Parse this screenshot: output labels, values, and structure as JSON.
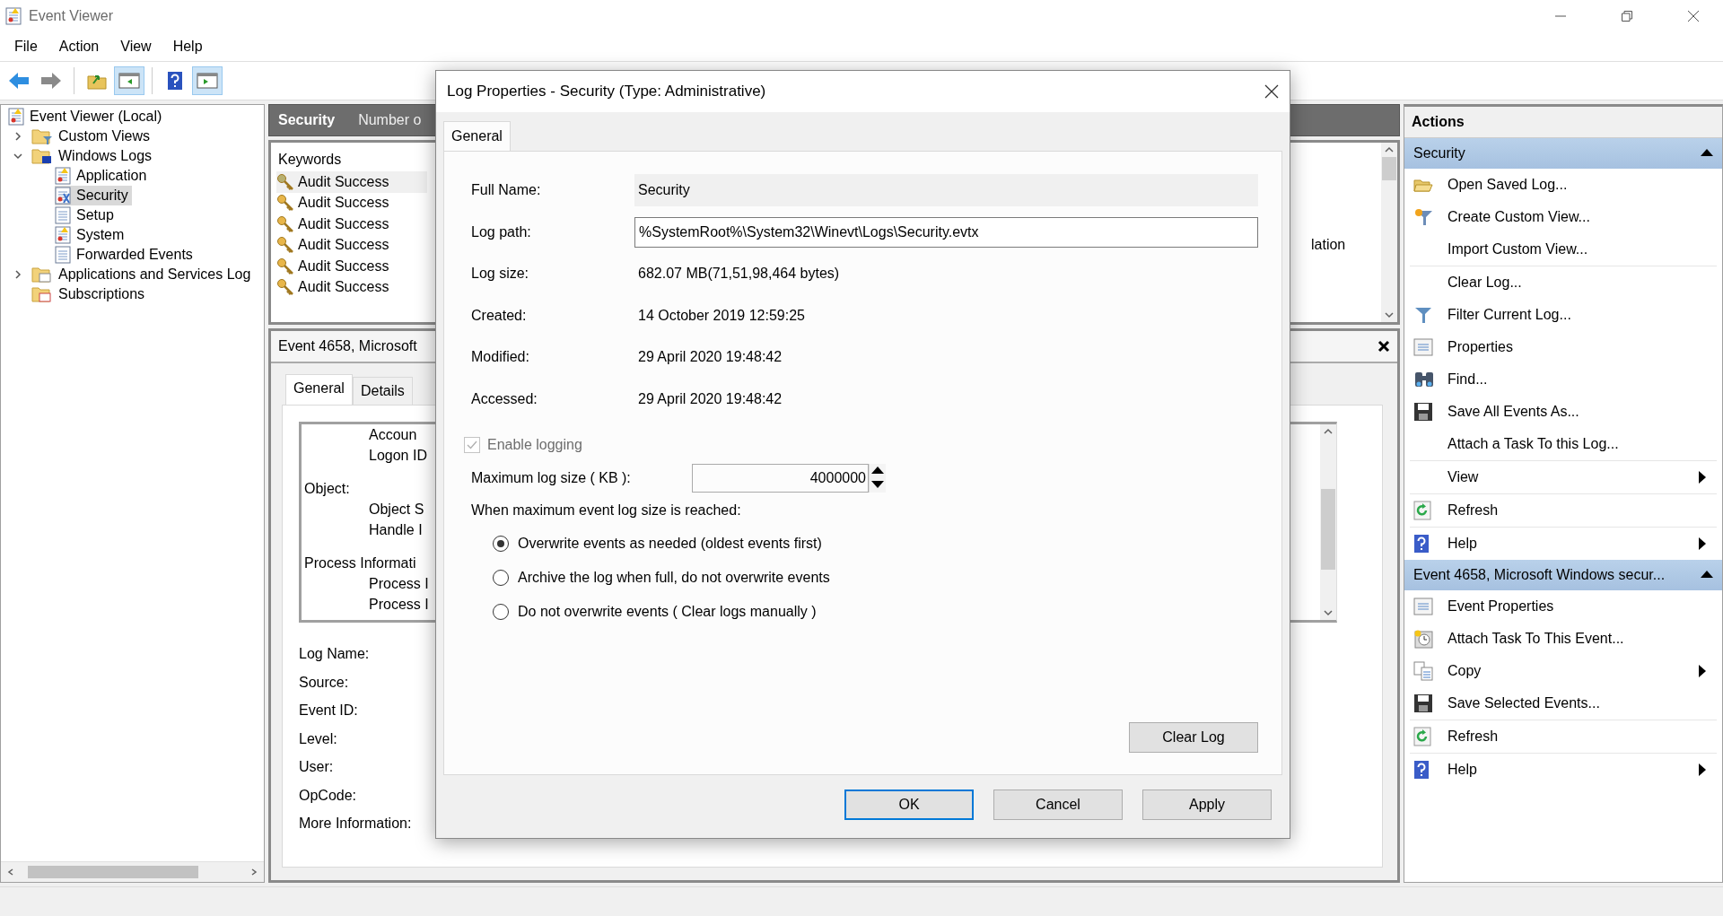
{
  "window": {
    "title": "Event Viewer"
  },
  "menu": [
    "File",
    "Action",
    "View",
    "Help"
  ],
  "toolbar_groups": [
    [
      {
        "kind": "back",
        "pressed": false
      },
      {
        "kind": "forward",
        "pressed": false
      }
    ],
    [
      {
        "kind": "up",
        "pressed": false
      },
      {
        "kind": "tree-pane",
        "pressed": true
      }
    ],
    [
      {
        "kind": "help",
        "pressed": false
      },
      {
        "kind": "action-pane",
        "pressed": true
      }
    ]
  ],
  "tree": [
    {
      "label": "Event Viewer (Local)",
      "kind": "viewer",
      "selected": false,
      "children": [
        {
          "label": "Custom Views",
          "kind": "filter-folder",
          "selected": false,
          "expanded": false
        },
        {
          "label": "Windows Logs",
          "kind": "logs-folder",
          "selected": false,
          "expanded": true,
          "children": [
            {
              "label": "Application",
              "kind": "log",
              "selected": false
            },
            {
              "label": "Security",
              "kind": "security-log",
              "selected": true
            },
            {
              "label": "Setup",
              "kind": "plain-log",
              "selected": false
            },
            {
              "label": "System",
              "kind": "log",
              "selected": false
            },
            {
              "label": "Forwarded Events",
              "kind": "plain-log",
              "selected": false
            }
          ]
        },
        {
          "label": "Applications and Services Log",
          "kind": "folder",
          "selected": false,
          "expanded": false
        },
        {
          "label": "Subscriptions",
          "kind": "subscriptions",
          "selected": false
        }
      ]
    }
  ],
  "log_header": {
    "title": "Security",
    "column_2": "Number o"
  },
  "event_list": {
    "column": "Keywords",
    "column_2_text": "lation",
    "rows": [
      {
        "text": "Audit Success",
        "selected": true
      },
      {
        "text": "Audit Success",
        "selected": false
      },
      {
        "text": "Audit Success",
        "selected": false
      },
      {
        "text": "Audit Success",
        "selected": false
      },
      {
        "text": "Audit Success",
        "selected": false
      },
      {
        "text": "Audit Success",
        "selected": false
      }
    ]
  },
  "event_detail": {
    "title": "Event 4658, Microsoft",
    "tabs": [
      {
        "label": "General",
        "selected": true
      },
      {
        "label": "Details",
        "selected": false
      }
    ],
    "lines": [
      {
        "text": "Accoun",
        "kind": "detail"
      },
      {
        "text": "Logon ID",
        "kind": "detail"
      },
      {
        "text": "Object:",
        "kind": "heading"
      },
      {
        "text": "Object S",
        "kind": "detail"
      },
      {
        "text": "Handle I",
        "kind": "detail"
      },
      {
        "text": "Process Informati",
        "kind": "heading"
      },
      {
        "text": "Process I",
        "kind": "detail"
      },
      {
        "text": "Process I",
        "kind": "detail"
      }
    ],
    "fields": [
      "Log Name:",
      "Source:",
      "Event ID:",
      "Level:",
      "User:",
      "OpCode:",
      "More Information:"
    ]
  },
  "actions": {
    "title": "Actions",
    "sections": [
      {
        "title": "Security",
        "expanded": true,
        "groups": [
          [
            {
              "label": "Open Saved Log...",
              "kind": "open",
              "submenu": false
            },
            {
              "label": "Create Custom View...",
              "kind": "funnel-star",
              "submenu": false
            },
            {
              "label": "Import Custom View...",
              "kind": "plain",
              "submenu": false
            }
          ],
          [
            {
              "label": "Clear Log...",
              "kind": "plain",
              "submenu": false
            },
            {
              "label": "Filter Current Log...",
              "kind": "funnel",
              "submenu": false
            },
            {
              "label": "Properties",
              "kind": "properties",
              "submenu": false
            },
            {
              "label": "Find...",
              "kind": "binoculars",
              "submenu": false
            },
            {
              "label": "Save All Events As...",
              "kind": "save",
              "submenu": false
            },
            {
              "label": "Attach a Task To this Log...",
              "kind": "plain",
              "submenu": false
            }
          ],
          [
            {
              "label": "View",
              "kind": "plain",
              "submenu": true
            }
          ],
          [
            {
              "label": "Refresh",
              "kind": "refresh",
              "submenu": false
            }
          ],
          [
            {
              "label": "Help",
              "kind": "help",
              "submenu": true
            }
          ]
        ]
      },
      {
        "title": "Event 4658, Microsoft Windows secur...",
        "expanded": true,
        "groups": [
          [
            {
              "label": "Event Properties",
              "kind": "properties",
              "submenu": false
            },
            {
              "label": "Attach Task To This Event...",
              "kind": "task",
              "submenu": false
            },
            {
              "label": "Copy",
              "kind": "copy",
              "submenu": true
            },
            {
              "label": "Save Selected Events...",
              "kind": "save",
              "submenu": false
            }
          ],
          [
            {
              "label": "Refresh",
              "kind": "refresh",
              "submenu": false
            }
          ],
          [
            {
              "label": "Help",
              "kind": "help",
              "submenu": true
            }
          ]
        ]
      }
    ]
  },
  "dialog": {
    "title": "Log Properties - Security (Type: Administrative)",
    "tabs": [
      {
        "label": "General",
        "selected": true
      }
    ],
    "fields": [
      {
        "label": "Full Name:",
        "value": "Security",
        "kind": "readonly"
      },
      {
        "label": "Log path:",
        "value": "%SystemRoot%\\System32\\Winevt\\Logs\\Security.evtx",
        "kind": "input"
      },
      {
        "label": "Log size:",
        "value": "682.07 MB(71,51,98,464 bytes)",
        "kind": "text"
      },
      {
        "label": "Created:",
        "value": "14 October 2019 12:59:25",
        "kind": "text"
      },
      {
        "label": "Modified:",
        "value": "29 April 2020 19:48:42",
        "kind": "text"
      },
      {
        "label": "Accessed:",
        "value": "29 April 2020 19:48:42",
        "kind": "text"
      }
    ],
    "enable_logging": {
      "label": "Enable logging",
      "checked": true,
      "disabled": true
    },
    "max_size": {
      "label": "Maximum log size ( KB ):",
      "value": "4000000"
    },
    "when_full": {
      "label": "When maximum event log size is reached:",
      "options": [
        {
          "label": "Overwrite events as needed (oldest events first)",
          "selected": true
        },
        {
          "label": "Archive the log when full, do not overwrite events",
          "selected": false
        },
        {
          "label": "Do not overwrite events ( Clear logs manually )",
          "selected": false
        }
      ]
    },
    "clear_button": "Clear Log",
    "buttons": [
      {
        "label": "OK",
        "default": true
      },
      {
        "label": "Cancel",
        "default": false
      },
      {
        "label": "Apply",
        "default": false
      }
    ]
  }
}
